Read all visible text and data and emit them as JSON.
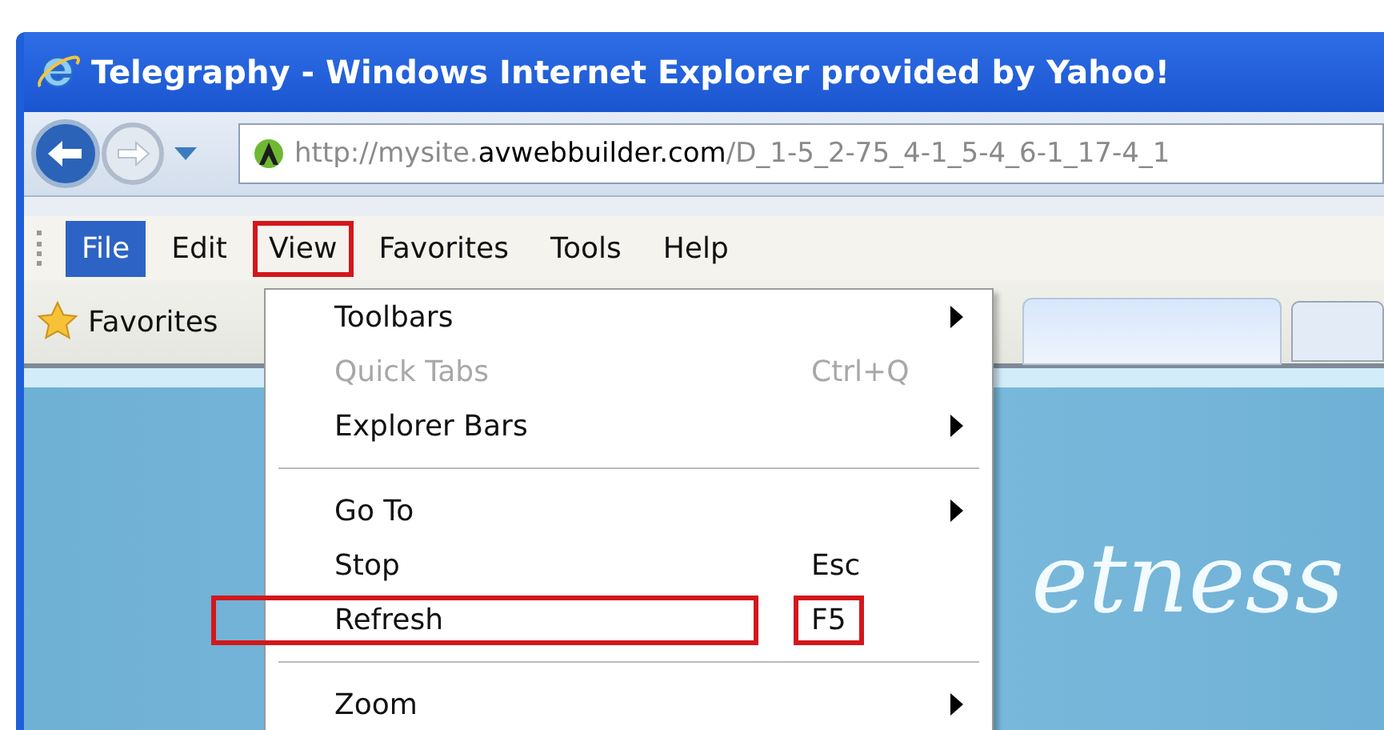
{
  "window": {
    "title": "Telegraphy - Windows Internet Explorer provided by Yahoo!"
  },
  "address": {
    "prefix": "http://mysite.",
    "domain": "avwebbuilder.com",
    "path": "/D_1-5_2-75_4-1_5-4_6-1_17-4_1"
  },
  "menu_bar": [
    {
      "label": "File",
      "selected": true,
      "annotated": false
    },
    {
      "label": "Edit",
      "selected": false,
      "annotated": false
    },
    {
      "label": "View",
      "selected": false,
      "annotated": true
    },
    {
      "label": "Favorites",
      "selected": false,
      "annotated": false
    },
    {
      "label": "Tools",
      "selected": false,
      "annotated": false
    },
    {
      "label": "Help",
      "selected": false,
      "annotated": false
    }
  ],
  "favorites_bar": {
    "label": "Favorites"
  },
  "view_menu": [
    {
      "kind": "item",
      "label": "Toolbars",
      "submenu": true,
      "disabled": false,
      "annotated": false
    },
    {
      "kind": "item",
      "label": "Quick Tabs",
      "shortcut": "Ctrl+Q",
      "submenu": false,
      "disabled": true,
      "annotated": false
    },
    {
      "kind": "item",
      "label": "Explorer Bars",
      "submenu": true,
      "disabled": false,
      "annotated": false
    },
    {
      "kind": "separator"
    },
    {
      "kind": "item",
      "label": "Go To",
      "submenu": true,
      "disabled": false,
      "annotated": false
    },
    {
      "kind": "item",
      "label": "Stop",
      "shortcut": "Esc",
      "submenu": false,
      "disabled": false,
      "annotated": false
    },
    {
      "kind": "item",
      "label": "Refresh",
      "shortcut": "F5",
      "submenu": false,
      "disabled": false,
      "annotated": true
    },
    {
      "kind": "separator"
    },
    {
      "kind": "item",
      "label": "Zoom",
      "submenu": true,
      "disabled": false,
      "annotated": false
    }
  ],
  "page": {
    "banner_text": "etness"
  }
}
